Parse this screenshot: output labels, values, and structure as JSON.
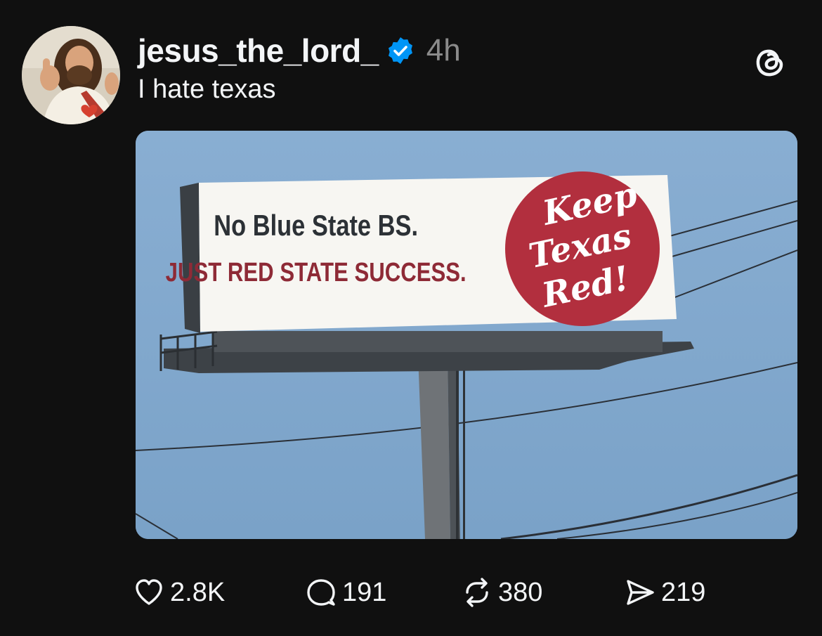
{
  "post": {
    "username": "jesus_the_lord_",
    "verified": true,
    "timestamp": "4h",
    "caption": "I hate texas",
    "media": {
      "billboard": {
        "line1": "No Blue State BS.",
        "line2": "JUST RED STATE SUCCESS.",
        "badge_lines": [
          "Keep",
          "Texas",
          "Red!"
        ],
        "badge_color": "#b22f3e"
      }
    },
    "actions": {
      "likes": "2.8K",
      "replies": "191",
      "reposts": "380",
      "shares": "219"
    }
  },
  "colors": {
    "background": "#101010",
    "text": "#f3f5f7",
    "muted": "#8b8b8b",
    "verified": "#0095f6",
    "sky": "#7fa6cc"
  },
  "icons": {
    "app": "threads-logo-icon",
    "like": "heart-icon",
    "reply": "comment-bubble-icon",
    "repost": "repost-icon",
    "share": "send-icon"
  }
}
